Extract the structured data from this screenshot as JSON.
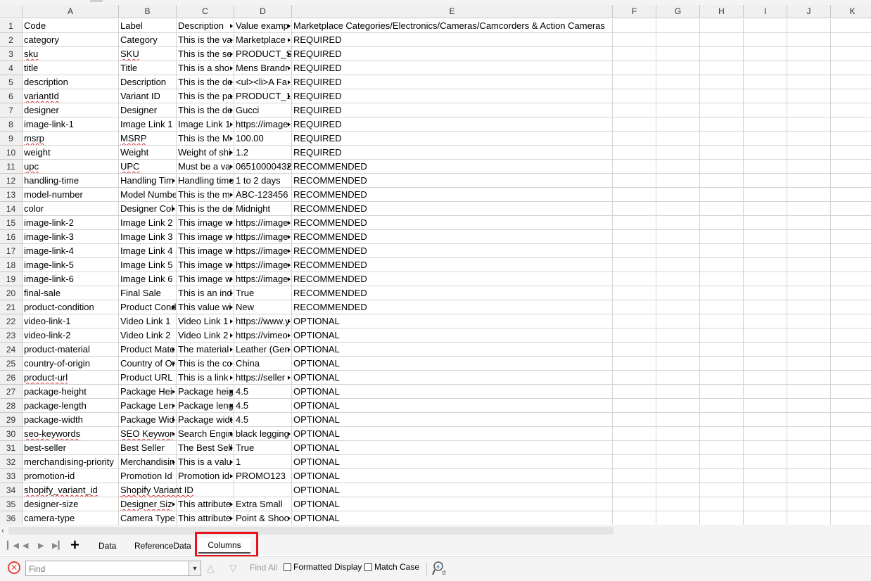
{
  "columns": [
    "A",
    "B",
    "C",
    "D",
    "E",
    "F",
    "G",
    "H",
    "I",
    "J",
    "K"
  ],
  "rows": [
    {
      "n": "1",
      "a": "Code",
      "b": "Label",
      "c": "Description",
      "d": "Value examp",
      "e": "Marketplace Categories/Electronics/Cameras/Camcorders & Action Cameras"
    },
    {
      "n": "2",
      "a": "category",
      "b": "Category",
      "c": "This is the va",
      "d": "Marketplace",
      "e": "REQUIRED"
    },
    {
      "n": "3",
      "a": "sku",
      "b": "SKU",
      "c": "This is the se",
      "d": "PRODUCT_S",
      "e": "REQUIRED"
    },
    {
      "n": "4",
      "a": "title",
      "b": "Title",
      "c": "This is a sho",
      "d": "Mens Brandr",
      "e": "REQUIRED"
    },
    {
      "n": "5",
      "a": "description",
      "b": "Description",
      "c": "This is the de",
      "d": "<ul><li>A Fa",
      "e": "REQUIRED"
    },
    {
      "n": "6",
      "a": "variantId",
      "b": "Variant ID",
      "c": "This is the pa",
      "d": "PRODUCT_1",
      "e": "REQUIRED"
    },
    {
      "n": "7",
      "a": "designer",
      "b": "Designer",
      "c": "This is the de",
      "d": "Gucci",
      "e": "REQUIRED"
    },
    {
      "n": "8",
      "a": "image-link-1",
      "b": "Image Link 1",
      "c": "Image Link 1",
      "d": "https://image",
      "e": "REQUIRED"
    },
    {
      "n": "9",
      "a": "msrp",
      "b": "MSRP",
      "c": "This is the M",
      "d": "100.00",
      "e": "REQUIRED"
    },
    {
      "n": "10",
      "a": "weight",
      "b": "Weight",
      "c": "Weight of shi",
      "d": "1.2",
      "e": "REQUIRED"
    },
    {
      "n": "11",
      "a": "upc",
      "b": "UPC",
      "c": "Must be a va",
      "d": "06510000432",
      "e": "RECOMMENDED"
    },
    {
      "n": "12",
      "a": "handling-time",
      "b": "Handling Tim",
      "c": "Handling time",
      "d": "1 to 2 days",
      "e": "RECOMMENDED"
    },
    {
      "n": "13",
      "a": "model-number",
      "b": "Model Numbe",
      "c": "This is the m",
      "d": "ABC-123456",
      "e": "RECOMMENDED"
    },
    {
      "n": "14",
      "a": "color",
      "b": "Designer Col",
      "c": "This is the de",
      "d": "Midnight",
      "e": "RECOMMENDED"
    },
    {
      "n": "15",
      "a": "image-link-2",
      "b": "Image Link 2",
      "c": "This image w",
      "d": "https://image",
      "e": "RECOMMENDED"
    },
    {
      "n": "16",
      "a": "image-link-3",
      "b": "Image Link 3",
      "c": "This image w",
      "d": "https://image",
      "e": "RECOMMENDED"
    },
    {
      "n": "17",
      "a": "image-link-4",
      "b": "Image Link 4",
      "c": "This image w",
      "d": "https://image",
      "e": "RECOMMENDED"
    },
    {
      "n": "18",
      "a": "image-link-5",
      "b": "Image Link 5",
      "c": "This image w",
      "d": "https://image",
      "e": "RECOMMENDED"
    },
    {
      "n": "19",
      "a": "image-link-6",
      "b": "Image Link 6",
      "c": "This image w",
      "d": "https://image",
      "e": "RECOMMENDED"
    },
    {
      "n": "20",
      "a": "final-sale",
      "b": "Final Sale",
      "c": "This is an ind",
      "d": "True",
      "e": "RECOMMENDED"
    },
    {
      "n": "21",
      "a": "product-condition",
      "b": "Product Cond",
      "c": "This value wi",
      "d": "New",
      "e": "RECOMMENDED"
    },
    {
      "n": "22",
      "a": "video-link-1",
      "b": "Video Link 1",
      "c": "Video Link 1",
      "d": "https://www.y",
      "e": "OPTIONAL"
    },
    {
      "n": "23",
      "a": "video-link-2",
      "b": "Video Link 2",
      "c": "Video Link 2",
      "d": "https://vimeo",
      "e": "OPTIONAL"
    },
    {
      "n": "24",
      "a": "product-material",
      "b": "Product Mate",
      "c": "The material",
      "d": "Leather (Gen",
      "e": "OPTIONAL"
    },
    {
      "n": "25",
      "a": "country-of-origin",
      "b": "Country of Or",
      "c": "This is the co",
      "d": "China",
      "e": "OPTIONAL"
    },
    {
      "n": "26",
      "a": "product-url",
      "b": "Product URL",
      "c": "This is a link",
      "d": "https://seller",
      "e": "OPTIONAL"
    },
    {
      "n": "27",
      "a": "package-height",
      "b": "Package Hei",
      "c": "Package heig",
      "d": "4.5",
      "e": "OPTIONAL"
    },
    {
      "n": "28",
      "a": "package-length",
      "b": "Package Len",
      "c": "Package leng",
      "d": "4.5",
      "e": "OPTIONAL"
    },
    {
      "n": "29",
      "a": "package-width",
      "b": "Package Wid",
      "c": "Package widt",
      "d": "4.5",
      "e": "OPTIONAL"
    },
    {
      "n": "30",
      "a": "seo-keywords",
      "b": "SEO Keywor",
      "c": "Search Engin",
      "d": "black legging",
      "e": "OPTIONAL"
    },
    {
      "n": "31",
      "a": "best-seller",
      "b": "Best Seller",
      "c": "The Best Sell",
      "d": "True",
      "e": "OPTIONAL"
    },
    {
      "n": "32",
      "a": "merchandising-priority",
      "b": "Merchandisin",
      "c": "This is a valu",
      "d": "1",
      "e": "OPTIONAL"
    },
    {
      "n": "33",
      "a": "promotion-id",
      "b": "Promotion Id",
      "c": "Promotion id",
      "d": "PROMO123",
      "e": "OPTIONAL"
    },
    {
      "n": "34",
      "a": "shopify_variant_id",
      "b": "Shopify Variant ID",
      "c": "",
      "d": "",
      "e": "OPTIONAL"
    },
    {
      "n": "35",
      "a": "designer-size",
      "b": "Designer Siz",
      "c": "This attribute",
      "d": "Extra Small",
      "e": "OPTIONAL"
    },
    {
      "n": "36",
      "a": "camera-type",
      "b": "Camera Type",
      "c": "This attribute",
      "d": "Point & Shoo",
      "e": "OPTIONAL"
    }
  ],
  "sheet_tabs": [
    "Data",
    "ReferenceData",
    "Columns"
  ],
  "active_tab": "Columns",
  "findbar": {
    "placeholder": "Find",
    "find_all": "Find All",
    "formatted_display": "Formatted Display",
    "match_case": "Match Case"
  }
}
